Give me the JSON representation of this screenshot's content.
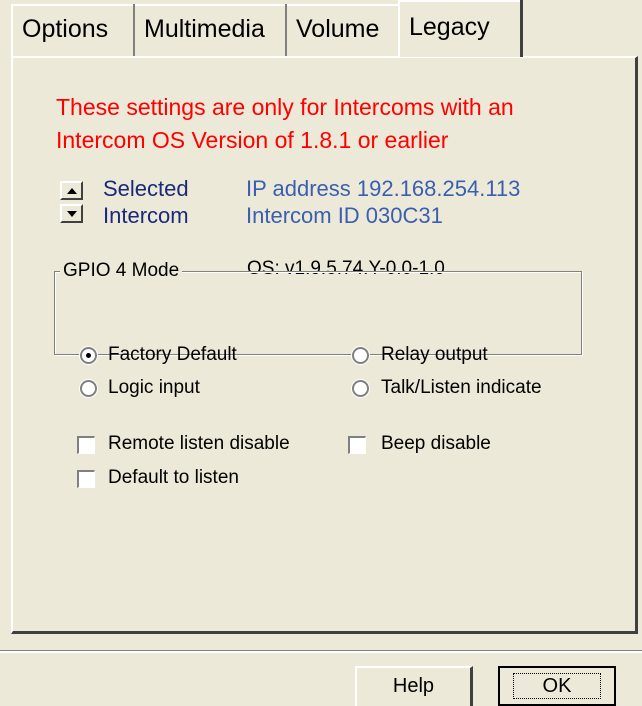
{
  "tabs": [
    "Options",
    "Multimedia",
    "Volume",
    "Legacy"
  ],
  "legacy": {
    "warning_line1": "These settings are only for Intercoms with an",
    "warning_line2": "Intercom OS Version of 1.8.1 or earlier",
    "selector_label1": "Selected",
    "selector_label2": "Intercom",
    "ip_text": "IP address 192.168.254.113",
    "id_text": "Intercom ID 030C31",
    "os_text": "OS:  v1.9.5.74.Y-0.0-1.0",
    "gpio_group_label": "GPIO 4  Mode",
    "gpio_options": [
      "Factory Default",
      "Relay output",
      "Logic input",
      "Talk/Listen indicate"
    ],
    "gpio_selected": "Factory Default",
    "checkboxes": [
      "Remote listen disable",
      "Beep disable",
      "Default to listen"
    ]
  },
  "buttons": {
    "help": "Help",
    "ok": "OK"
  },
  "colors": {
    "warning": "#ff0000",
    "info_blue": "#3a5fb0",
    "label_navy": "#1a2a78",
    "dialog_bg": "#ece9d8"
  }
}
